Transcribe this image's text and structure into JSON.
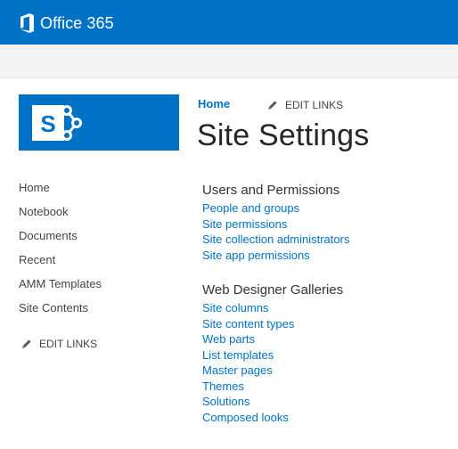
{
  "suitebar": {
    "brand": "Office 365",
    "color": "#0072c6"
  },
  "breadcrumb": {
    "home": "Home"
  },
  "edit_links": "EDIT LINKS",
  "page_title": "Site Settings",
  "left_nav": {
    "items": [
      "Home",
      "Notebook",
      "Documents",
      "Recent",
      "AMM Templates",
      "Site Contents"
    ],
    "edit_links": "EDIT LINKS"
  },
  "groups": [
    {
      "title": "Users and Permissions",
      "links": [
        "People and groups",
        "Site permissions",
        "Site collection administrators",
        "Site app permissions"
      ]
    },
    {
      "title": "Web Designer Galleries",
      "links": [
        "Site columns",
        "Site content types",
        "Web parts",
        "List templates",
        "Master pages",
        "Themes",
        "Solutions",
        "Composed looks"
      ]
    }
  ],
  "icons": [
    "office-logo-icon",
    "sharepoint-logo-icon",
    "pencil-icon"
  ]
}
